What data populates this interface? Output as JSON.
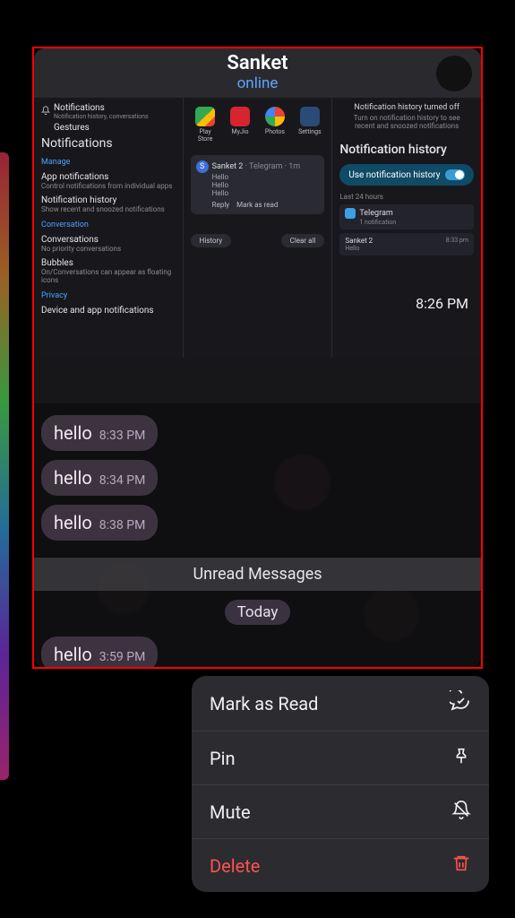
{
  "header": {
    "title": "Sanket",
    "status": "online"
  },
  "settingsPane": {
    "row1": {
      "title": "Notifications",
      "sub": "Notification history, conversations"
    },
    "row2": "Gestures",
    "heading": "Notifications",
    "sections": {
      "manage": "Manage",
      "conversation": "Conversation",
      "privacy": "Privacy"
    },
    "items": {
      "appNotif": {
        "t": "App notifications",
        "s": "Control notifications from individual apps"
      },
      "history": {
        "t": "Notification history",
        "s": "Show recent and snoozed notifications"
      },
      "conv": {
        "t": "Conversations",
        "s": "No priority conversations"
      },
      "bubbles": {
        "t": "Bubbles",
        "s": "On/Conversations can appear as floating icons"
      },
      "device": {
        "t": "Device and app notifications"
      }
    }
  },
  "apps": [
    {
      "label": "Play Store",
      "color": "#ffffff"
    },
    {
      "label": "MyJio",
      "color": "#d6252e"
    },
    {
      "label": "Photos",
      "color": "#ffffff"
    },
    {
      "label": "Settings",
      "color": "#2a4b75"
    }
  ],
  "notifCard": {
    "sender": "Sanket 2",
    "via": "· Telegram · 1m",
    "lines": [
      "Hello",
      "Hello",
      "Hello"
    ],
    "actions": {
      "reply": "Reply",
      "mark": "Mark as read"
    }
  },
  "pills": {
    "history": "History",
    "clear": "Clear all"
  },
  "historyPane": {
    "hintTitle": "Notification history turned off",
    "hintBody": "Turn on notification history to see recent and snoozed notifications",
    "heading": "Notification history",
    "toggle": "Use notification history",
    "last24": "Last 24 hours",
    "telegram": {
      "name": "Telegram",
      "count": "1 notification"
    },
    "item": {
      "sender": "Sanket 2",
      "msg": "Hello",
      "time": "8:33 pm"
    },
    "time": "8:26 PM"
  },
  "messages": [
    {
      "text": "hello",
      "time": "8:33 PM"
    },
    {
      "text": "hello",
      "time": "8:34 PM"
    },
    {
      "text": "hello",
      "time": "8:38 PM"
    }
  ],
  "unreadLabel": "Unread Messages",
  "dayLabel": "Today",
  "messagesAfter": [
    {
      "text": "hello",
      "time": "3:59 PM"
    }
  ],
  "menu": {
    "markRead": "Mark as Read",
    "pin": "Pin",
    "mute": "Mute",
    "delete": "Delete"
  }
}
